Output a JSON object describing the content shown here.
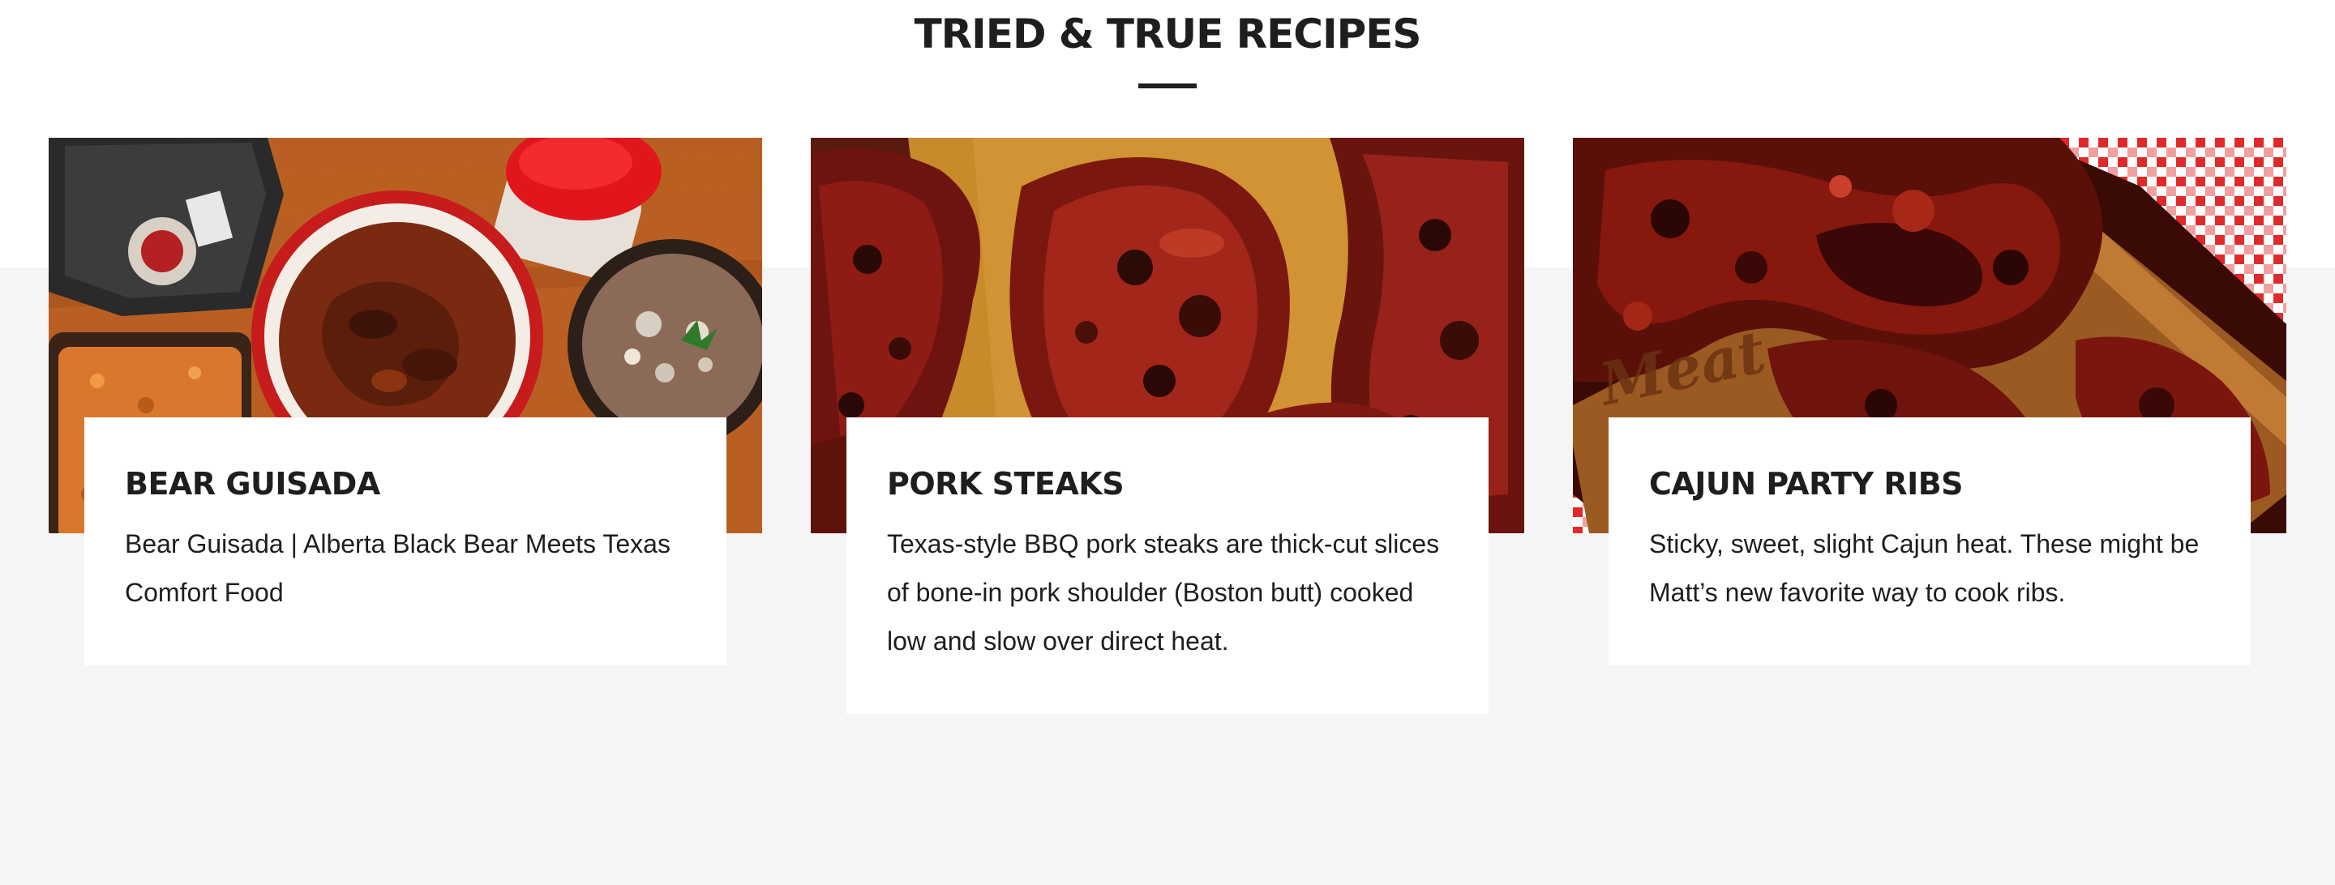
{
  "section": {
    "title": "TRIED & TRUE RECIPES"
  },
  "recipes": [
    {
      "title": "BEAR GUISADA",
      "description": "Bear Guisada | Alberta Black Bear Meets Texas Comfort Food",
      "image_alt": "bear guisada bowls on a wooden cutting board"
    },
    {
      "title": "PORK STEAKS",
      "description": "Texas-style BBQ pork steaks are thick-cut slices of bone-in pork shoulder (Boston butt) cooked low and slow over direct heat.",
      "image_alt": "glazed bbq pork steaks on a wooden board"
    },
    {
      "title": "CAJUN PARTY RIBS",
      "description": "Sticky, sweet, slight Cajun heat. These might be Matt’s new favorite way to cook ribs.",
      "image_alt": "cajun party ribs on a board with red checkered cloth"
    }
  ],
  "colors": {
    "heading": "#1e1e1e",
    "band": "#f5f5f5",
    "card": "#ffffff"
  }
}
